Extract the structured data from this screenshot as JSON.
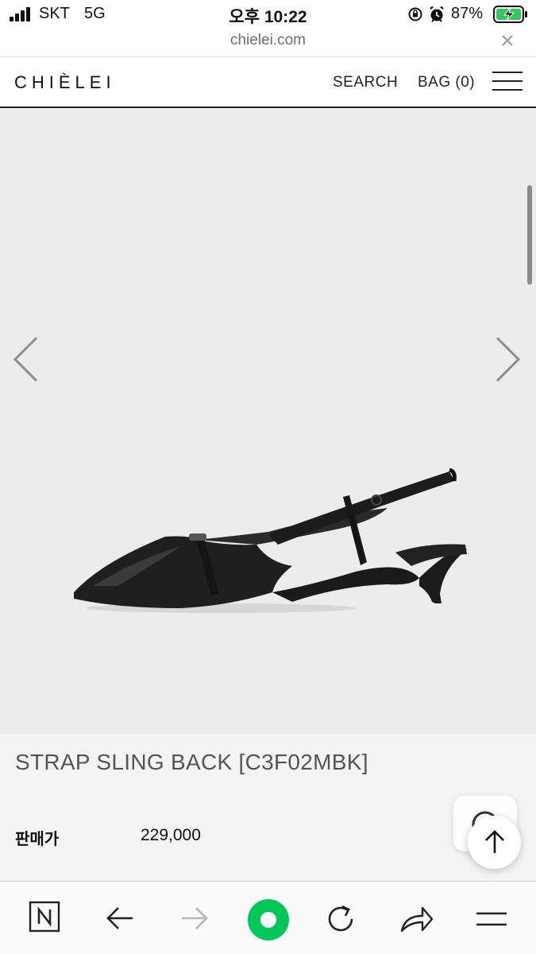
{
  "status_bar": {
    "carrier": "SKT",
    "network": "5G",
    "time": "오후 10:22",
    "battery_percent": "87%"
  },
  "browser": {
    "url": "chielei.com"
  },
  "header": {
    "logo": "CHIÈLEI",
    "search_label": "SEARCH",
    "bag_label": "BAG (0)"
  },
  "product": {
    "title": "STRAP SLING BACK [C3F02MBK]",
    "price_label": "판매가",
    "price_value": "229,000"
  },
  "icons": {
    "prev": "chevron-left-icon",
    "next": "chevron-right-icon",
    "menu": "hamburger-menu-icon",
    "scroll_top": "arrow-up-icon"
  },
  "colors": {
    "image_background": "#ececec",
    "info_background": "#f4f4f4",
    "naver_green": "#03c75a"
  }
}
